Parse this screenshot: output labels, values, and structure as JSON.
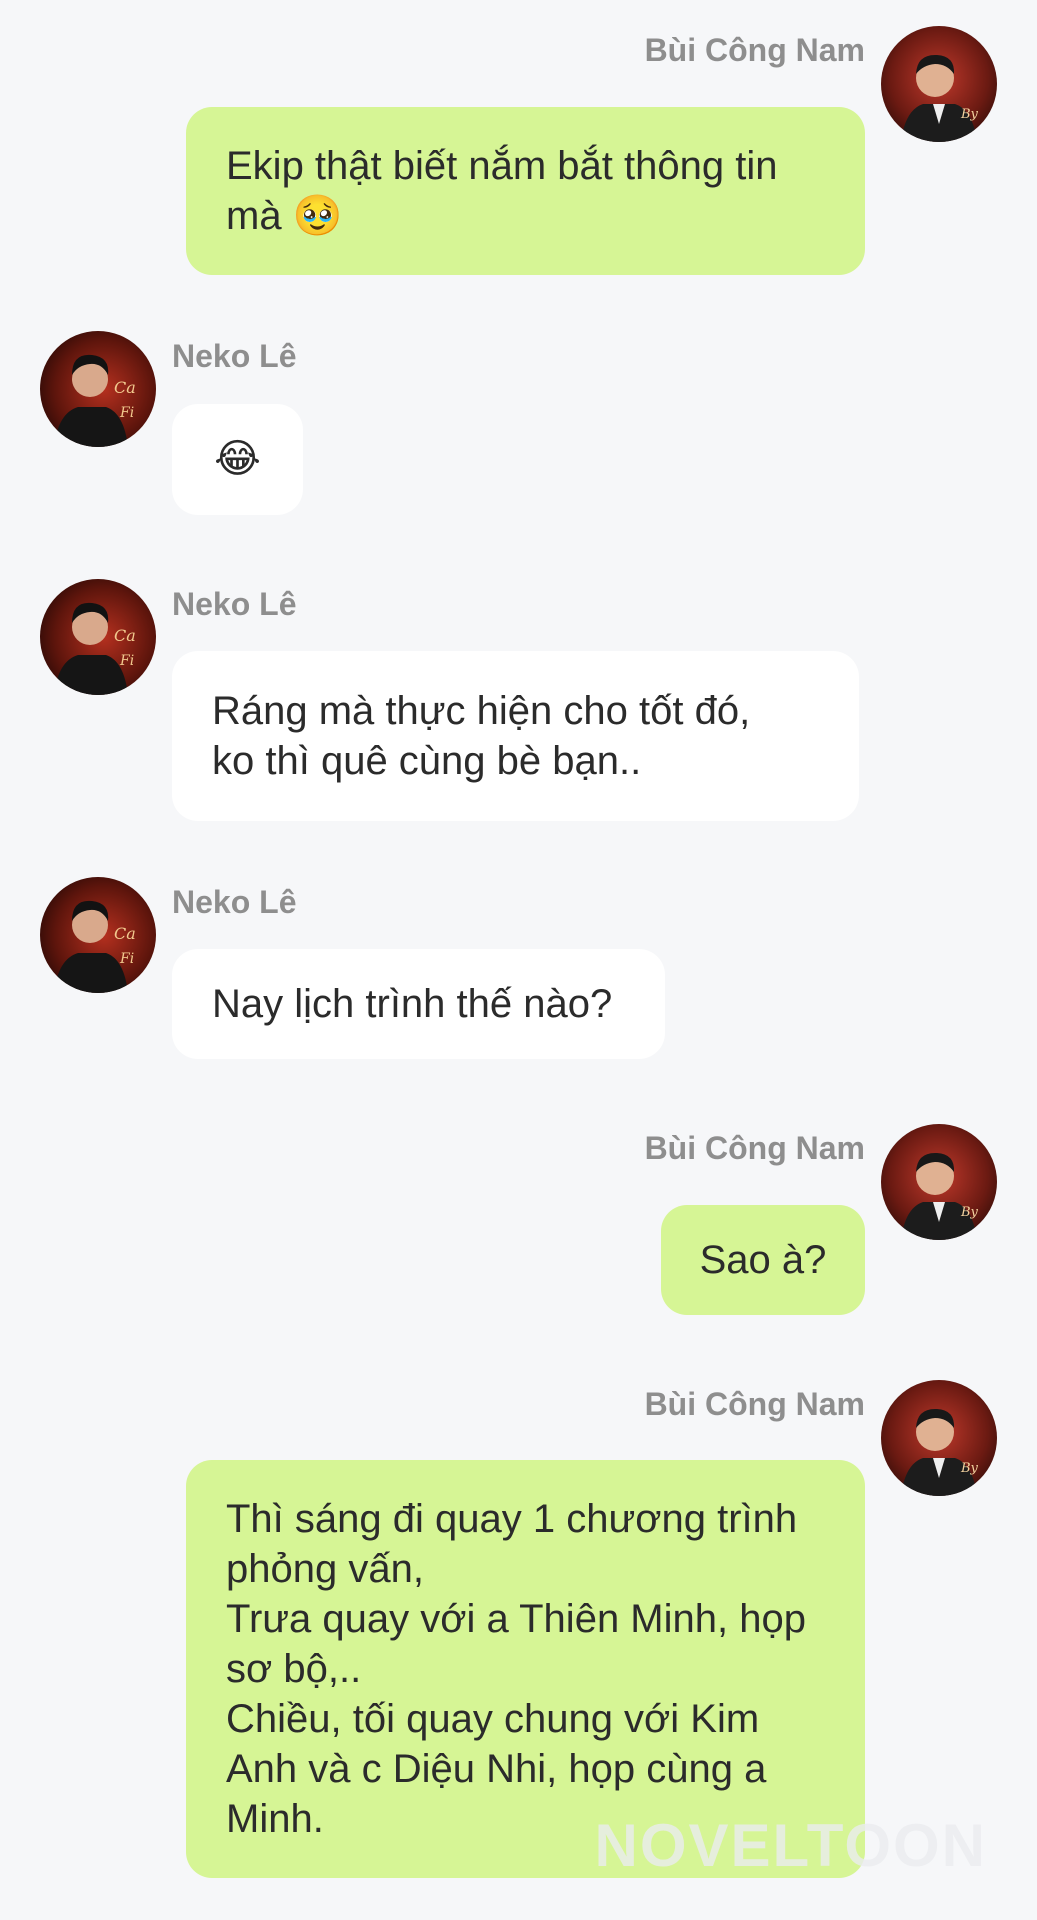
{
  "messages": [
    {
      "sender": "Bùi Công Nam",
      "text": "Ekip thật biết nắm bắt thông tin mà 🥹"
    },
    {
      "sender": "Neko Lê",
      "text": "😂"
    },
    {
      "sender": "Neko Lê",
      "text": "Ráng mà thực hiện cho tốt đó,\nko thì quê cùng bè bạn.."
    },
    {
      "sender": "Neko Lê",
      "text": "Nay lịch trình thế nào?"
    },
    {
      "sender": "Bùi Công Nam",
      "text": "Sao à?"
    },
    {
      "sender": "Bùi Công Nam",
      "text": "Thì sáng đi quay 1 chương trình phỏng vấn,\nTrưa quay với a Thiên Minh, họp sơ bộ,..\nChiều, tối quay chung với Kim Anh và c Diệu Nhi, họp cùng a Minh."
    }
  ],
  "watermark": "NOVELTOON",
  "colors": {
    "my_bubble": "#d6f595",
    "their_bubble": "#ffffff",
    "background": "#f6f7f9",
    "sender_name": "#8e8e8e"
  },
  "icons": {
    "my_avatar": "avatar-bui-cong-nam",
    "their_avatar": "avatar-neko-le"
  }
}
